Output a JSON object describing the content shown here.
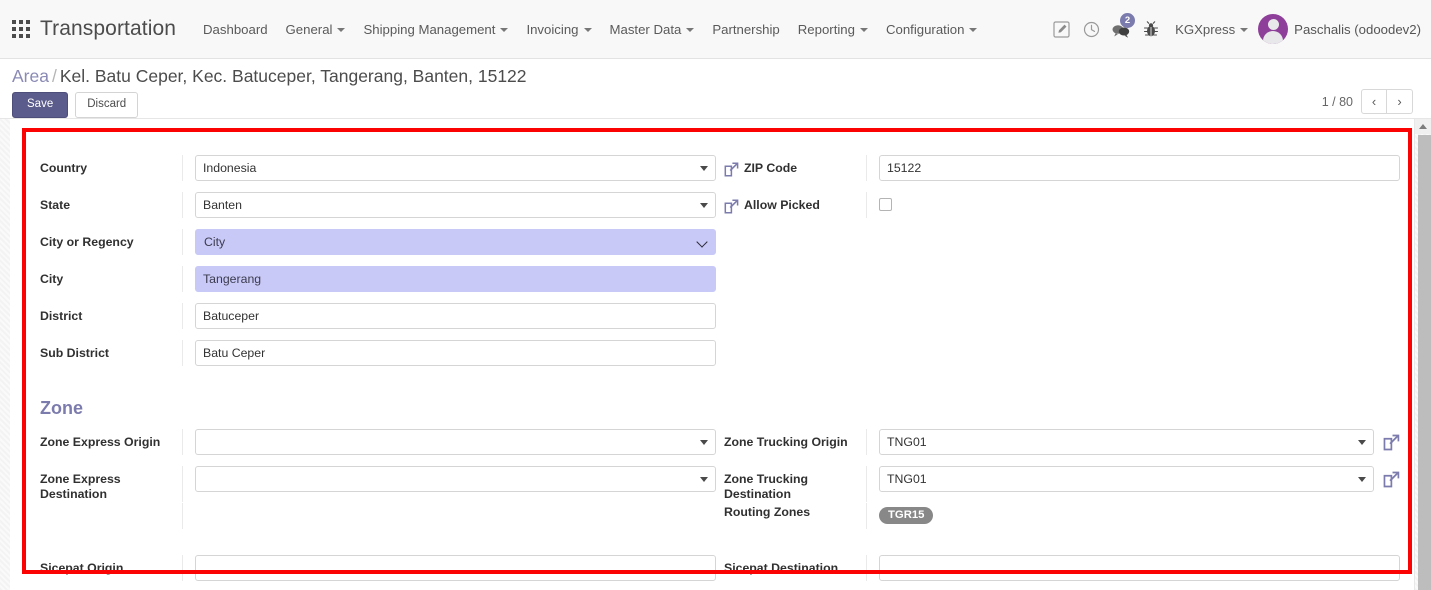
{
  "navbar": {
    "apps_icon": "apps-grid-icon",
    "brand": "Transportation",
    "menu": [
      {
        "label": "Dashboard",
        "has_caret": false
      },
      {
        "label": "General",
        "has_caret": true
      },
      {
        "label": "Shipping Management",
        "has_caret": true
      },
      {
        "label": "Invoicing",
        "has_caret": true
      },
      {
        "label": "Master Data",
        "has_caret": true
      },
      {
        "label": "Partnership",
        "has_caret": false
      },
      {
        "label": "Reporting",
        "has_caret": true
      },
      {
        "label": "Configuration",
        "has_caret": true
      }
    ],
    "icons": [
      {
        "name": "edit-note-icon"
      },
      {
        "name": "clock-icon"
      },
      {
        "name": "messages-icon",
        "badge": "2"
      },
      {
        "name": "bug-icon"
      }
    ],
    "company": "KGXpress",
    "user": "Paschalis (odoodev2)",
    "avatar_name": "user-avatar",
    "accent_color": "#7c7bad",
    "avatar_color": "#8e3f99"
  },
  "control_panel": {
    "breadcrumb_root": "Area",
    "breadcrumb_sep": "/",
    "breadcrumb_current": "Kel. Batu Ceper, Kec. Batuceper, Tangerang, Banten, 15122",
    "save_label": "Save",
    "discard_label": "Discard",
    "pager_count": "1 / 80",
    "prev_icon": "chevron-left-icon",
    "next_icon": "chevron-right-icon"
  },
  "form": {
    "left_fields": [
      {
        "label": "Country",
        "value": "Indonesia",
        "type": "many2one"
      },
      {
        "label": "State",
        "value": "Banten",
        "type": "many2one"
      },
      {
        "label": "City or Regency",
        "value": "City",
        "type": "select",
        "highlight": true
      },
      {
        "label": "City",
        "value": "Tangerang",
        "type": "text",
        "highlight": true
      },
      {
        "label": "District",
        "value": "Batuceper",
        "type": "text"
      },
      {
        "label": "Sub District",
        "value": "Batu Ceper",
        "type": "text"
      }
    ],
    "right_fields": [
      {
        "label": "ZIP Code",
        "value": "15122",
        "type": "text",
        "ext_link": true
      },
      {
        "label": "Allow Picked",
        "value": "",
        "type": "checkbox",
        "ext_link": true,
        "checked": false
      }
    ],
    "zone": {
      "title": "Zone",
      "left_fields": [
        {
          "label": "Zone Express Origin",
          "value": "",
          "type": "many2one"
        },
        {
          "label": "Zone Express Destination",
          "value": "",
          "type": "many2one"
        },
        {
          "label": "Sicepat Origin",
          "value": "",
          "type": "text"
        }
      ],
      "right_fields": [
        {
          "label": "Zone Trucking Origin",
          "value": "TNG01",
          "type": "many2one",
          "ext_link": true
        },
        {
          "label": "Zone Trucking Destination",
          "value": "TNG01",
          "type": "many2one",
          "ext_link": true
        },
        {
          "label": "Routing Zones",
          "tags": [
            "TGR15"
          ],
          "type": "tags"
        },
        {
          "label": "Sicepat Destination",
          "value": "",
          "type": "text"
        }
      ]
    }
  },
  "annotation": {
    "highlight_box": "red-rectangle-overlay",
    "color": "#fb0303"
  },
  "scrollbar": {
    "up_arrow": "scroll-up-arrow-icon",
    "thumb": "scroll-thumb"
  }
}
